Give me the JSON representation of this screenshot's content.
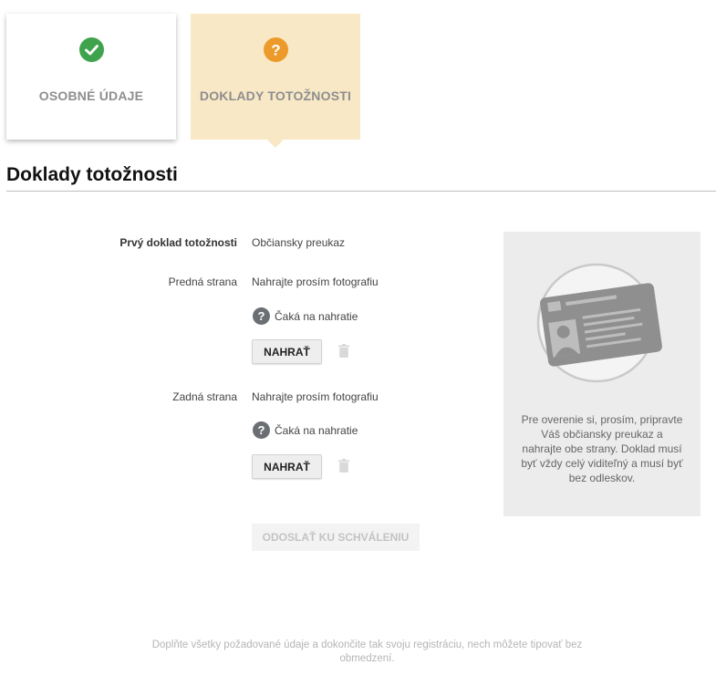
{
  "steps": [
    {
      "label": "OSOBNÉ ÚDAJE",
      "state": "completed",
      "icon": "check-circle-icon",
      "color": "#3fa34d"
    },
    {
      "label": "DOKLADY TOTOŽNOSTI",
      "state": "active",
      "icon": "question-circle-icon",
      "color": "#ec9a29"
    }
  ],
  "section": {
    "title": "Doklady totožnosti"
  },
  "document": {
    "label": "Prvý doklad totožnosti",
    "value": "Občiansky preukaz"
  },
  "front": {
    "label": "Predná strana",
    "prompt": "Nahrajte prosím fotografiu",
    "status": "Čaká na nahratie",
    "upload_label": "NAHRAŤ"
  },
  "back": {
    "label": "Zadná strana",
    "prompt": "Nahrajte prosím fotografiu",
    "status": "Čaká na nahratie",
    "upload_label": "NAHRAŤ"
  },
  "submit": {
    "label": "ODOSLAŤ KU SCHVÁLENIU",
    "enabled": false
  },
  "info_panel": {
    "text": "Pre overenie si, prosím, pripravte Váš občiansky preukaz a nahrajte obe strany. Doklad musí byť vždy celý viditeľný a musí byť bez odleskov.",
    "icon": "id-card-illustration"
  },
  "footer": {
    "note": "Doplňte všetky požadované údaje a dokončite tak svoju registráciu, nech môžete tipovať bez obmedzení."
  },
  "colors": {
    "accent_active_bg": "#f8e8c6",
    "success": "#3fa34d",
    "warning": "#ec9a29",
    "status_icon": "#6b6f74"
  }
}
